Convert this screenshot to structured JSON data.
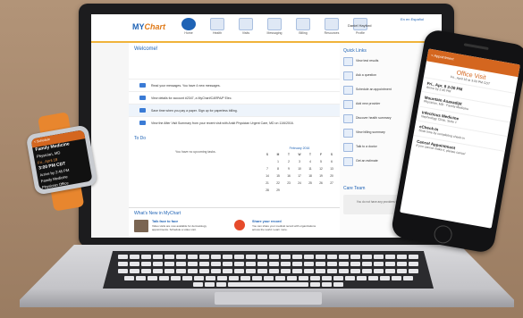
{
  "app": {
    "logo_prefix": "MY",
    "logo_suffix": "Chart"
  },
  "header": {
    "nav": [
      "Home",
      "Health",
      "Visits",
      "Messaging",
      "Billing",
      "Resources",
      "Profile"
    ],
    "user_name": "Daniel Hayford",
    "language_link": "En en Español"
  },
  "welcome": {
    "title": "Welcome!",
    "messages": [
      "Read your messages. You have 4 new messages.",
      "View details for account #2347, a MyChart/CARPA/P Elec.",
      "Save time when you pay a paper. Sign up for paperless billing.",
      "View the After Visit Summary from your recent visit with Ankit Physician Urgent Care, MD on 11/6/2016."
    ]
  },
  "todo": {
    "title": "To Do",
    "empty_text": "You have no upcoming tasks.",
    "calendar_month": "February 2016",
    "weekdays": [
      "S",
      "M",
      "T",
      "W",
      "T",
      "F",
      "S"
    ],
    "weeks": [
      [
        "",
        "1",
        "2",
        "3",
        "4",
        "5",
        "6"
      ],
      [
        "7",
        "8",
        "9",
        "10",
        "11",
        "12",
        "13"
      ],
      [
        "14",
        "15",
        "16",
        "17",
        "18",
        "19",
        "20"
      ],
      [
        "21",
        "22",
        "23",
        "24",
        "25",
        "26",
        "27"
      ],
      [
        "28",
        "29",
        "",
        "",
        "",
        "",
        ""
      ]
    ]
  },
  "news": {
    "title": "What's New in MyChart",
    "cards": [
      {
        "title": "Talk face to face",
        "desc": "Video visits are now available for dermatology appointments. Schedule a video visit."
      },
      {
        "title": "Share your record",
        "desc": "You can share your medical record with organizations across the world. Learn more."
      }
    ]
  },
  "quick_links": {
    "title": "Quick Links",
    "items": [
      "View test results",
      "Ask a question",
      "Schedule an appointment",
      "Add new provider",
      "Discover health summary",
      "View billing summary",
      "Talk to a doctor",
      "Get an estimate"
    ]
  },
  "care_team": {
    "title": "Care Team",
    "empty_text": "You do not have any providers to display at this time."
  },
  "watch": {
    "header": "< Schedule",
    "lines": [
      "Family Medicine",
      "Physician, MD",
      "Fri., April 18",
      "3:00 PM CDT",
      "Arrive by 2:45 PM",
      "Family Medicine",
      "Physician Office"
    ]
  },
  "phone": {
    "bar": "< Appointment",
    "title": "Office Visit",
    "subtitle": "Fri., April 18 at 3:00 PM CDT",
    "rows": [
      {
        "a": "Fri., Apr. 8 3:00 PM",
        "b": "Arrive by 2:45 PM"
      },
      {
        "a": "Mountain Asavadijit",
        "b": "Physician, MD · Family Medicine"
      },
      {
        "a": "Infectious Medicine",
        "b": "Nephrology Clinic, Suite 1"
      },
      {
        "a": "eCheck-In",
        "b": "Save time by completing check-in"
      },
      {
        "a": "Cancel Appointment",
        "b": "If you cannot make it, please cancel"
      }
    ]
  }
}
